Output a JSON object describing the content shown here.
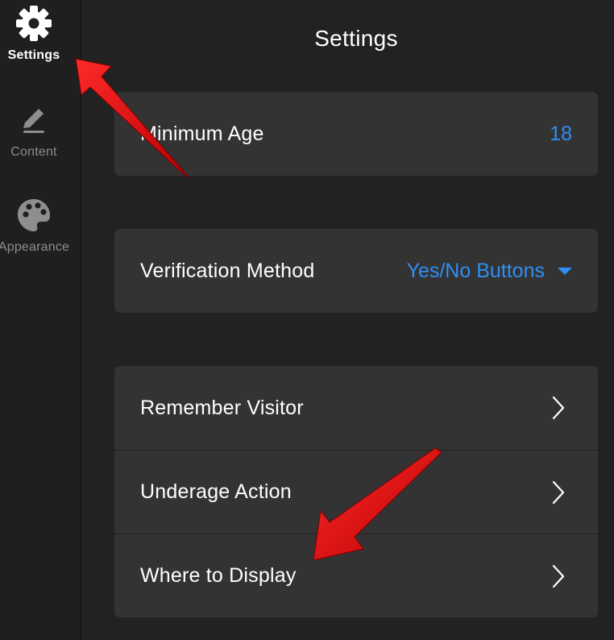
{
  "sidebar": {
    "items": [
      {
        "label": "Settings",
        "icon": "gear-icon",
        "active": true
      },
      {
        "label": "Content",
        "icon": "pen-icon",
        "active": false
      },
      {
        "label": "Appearance",
        "icon": "palette-icon",
        "active": false
      }
    ]
  },
  "header": {
    "title": "Settings"
  },
  "settings": {
    "minimum_age": {
      "label": "Minimum Age",
      "value": "18"
    },
    "verification_method": {
      "label": "Verification Method",
      "value": "Yes/No Buttons"
    },
    "links": [
      {
        "label": "Remember Visitor",
        "icon": "chevron-right-icon"
      },
      {
        "label": "Underage Action",
        "icon": "chevron-right-icon"
      },
      {
        "label": "Where to Display",
        "icon": "chevron-right-icon"
      }
    ]
  },
  "colors": {
    "background": "#222222",
    "sidebar": "#1f1f1f",
    "card": "#333333",
    "accent": "#2f8ff5",
    "annotation_arrow": "#d10a0a",
    "inactive_text": "#8e8e8e"
  }
}
